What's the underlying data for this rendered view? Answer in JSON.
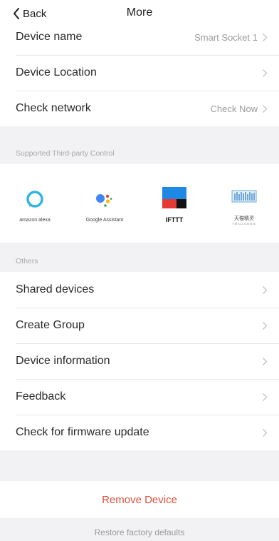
{
  "nav": {
    "back_label": "Back",
    "title": "More"
  },
  "device_settings": [
    {
      "label": "Device name",
      "value": "Smart Socket 1"
    },
    {
      "label": "Device Location",
      "value": ""
    },
    {
      "label": "Check network",
      "value": "Check Now"
    }
  ],
  "third_party": {
    "section_label": "Supported Third-party Control",
    "services": [
      {
        "name": "amazon alexa",
        "icon": "alexa-icon"
      },
      {
        "name": "Google Assistant",
        "icon": "google-assistant-icon"
      },
      {
        "name": "IFTTT",
        "icon": "ifttt-icon"
      },
      {
        "name": "天猫精灵",
        "subname": "TMALLGENIE",
        "icon": "tmall-genie-icon"
      }
    ]
  },
  "others": {
    "section_label": "Others",
    "items": [
      {
        "label": "Shared devices"
      },
      {
        "label": "Create Group"
      },
      {
        "label": "Device information"
      },
      {
        "label": "Feedback"
      },
      {
        "label": "Check for firmware update"
      }
    ]
  },
  "actions": {
    "remove_label": "Remove Device",
    "restore_label": "Restore factory defaults"
  },
  "colors": {
    "remove": "#e0503f",
    "background": "#f2f2f4",
    "chevron": "#c7c7cc"
  }
}
